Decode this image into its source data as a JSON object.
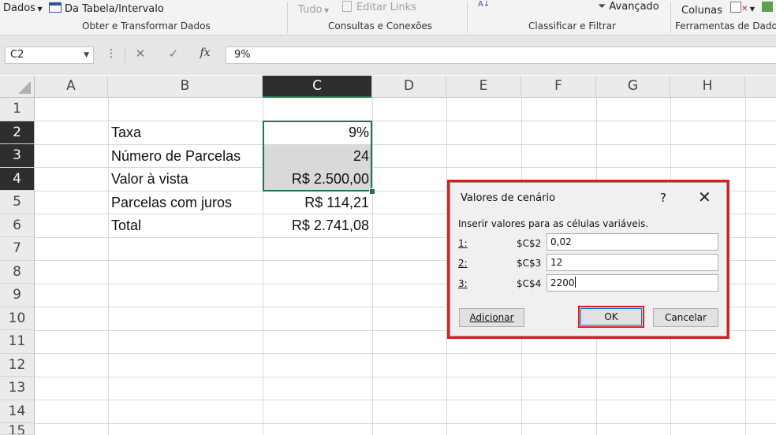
{
  "ribbon": {
    "dados_label": "Dados",
    "da_tabela_label": "Da Tabela/Intervalo",
    "tudo_label": "Tudo",
    "editar_links_label": "Editar Links",
    "avancado_label": "Avançado",
    "colunas_label": "Colunas",
    "groups": {
      "obter": "Obter e Transformar Dados",
      "consultas": "Consultas e Conexões",
      "classificar": "Classificar e Filtrar",
      "ferramentas": "Ferramentas de Dados"
    }
  },
  "formula_bar": {
    "name_box": "C2",
    "formula_value": "9%",
    "dots": "⋮",
    "cancel_glyph": "✕",
    "enter_glyph": "✓",
    "fx_glyph": "fx"
  },
  "sheet": {
    "columns": [
      "A",
      "B",
      "C",
      "D",
      "E",
      "F",
      "G",
      "H"
    ],
    "selected_column": "C",
    "rows": [
      "1",
      "2",
      "3",
      "4",
      "5",
      "6",
      "7",
      "8",
      "9",
      "10",
      "11",
      "12",
      "13",
      "14",
      "15"
    ],
    "selected_rows": [
      "2",
      "3",
      "4"
    ],
    "cells": {
      "B2": "Taxa",
      "C2": "9%",
      "B3": "Número de Parcelas",
      "C3": "24",
      "B4": "Valor à vista",
      "C4": "R$ 2.500,00",
      "B5": "Parcelas com juros",
      "C5": "R$ 114,21",
      "B6": "Total",
      "C6": "R$ 2.741,08"
    }
  },
  "dialog": {
    "title": "Valores de cenário",
    "help": "?",
    "close": "✕",
    "instruction": "Inserir valores para as células variáveis.",
    "rows": [
      {
        "num": "1:",
        "ref": "$C$2",
        "value": "0,02"
      },
      {
        "num": "2:",
        "ref": "$C$3",
        "value": "12"
      },
      {
        "num": "3:",
        "ref": "$C$4",
        "value": "2200"
      }
    ],
    "add_button": "Adicionar",
    "ok_button": "OK",
    "cancel_button": "Cancelar"
  },
  "colors": {
    "excel_green": "#217346",
    "highlight_red": "#e01b1b",
    "header_selected": "#2e2e2e"
  }
}
